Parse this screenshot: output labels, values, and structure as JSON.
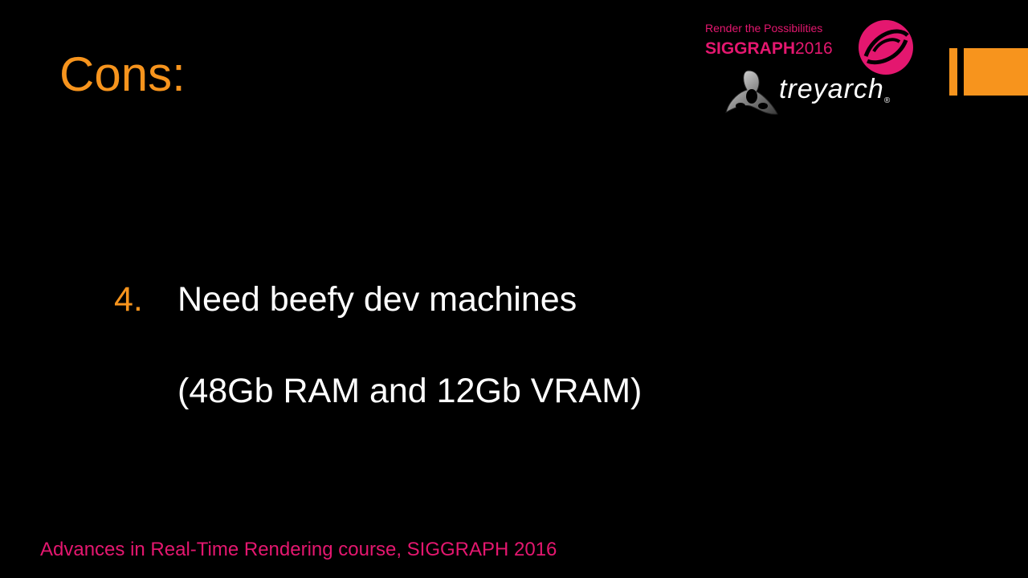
{
  "slide": {
    "title": "Cons:",
    "list_number": "4.",
    "line1": "Need beefy dev machines",
    "line2": "(48Gb RAM and 12Gb VRAM)"
  },
  "logos": {
    "siggraph_tagline": "Render the Possibilities",
    "siggraph_name": "SIGGRAPH",
    "siggraph_year": "2016",
    "treyarch_name": "treyarch",
    "treyarch_mark": "®"
  },
  "footer": {
    "text": "Advances in Real-Time Rendering course, SIGGRAPH 2016"
  },
  "colors": {
    "background": "#000000",
    "accent_orange": "#f7941d",
    "brand_pink": "#e4176f",
    "text_white": "#ffffff"
  }
}
